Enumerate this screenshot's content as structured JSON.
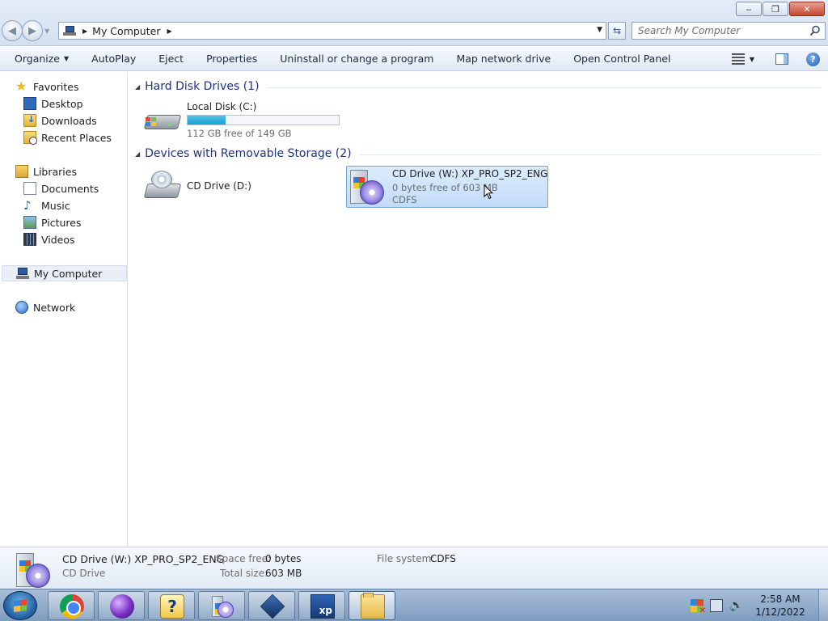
{
  "window": {
    "minimize_glyph": "‒",
    "restore_glyph": "❐",
    "close_glyph": "✕"
  },
  "nav": {
    "back_glyph": "◀",
    "forward_glyph": "▶"
  },
  "address": {
    "crumb": "My Computer",
    "dropdown_glyph": "▼"
  },
  "search": {
    "placeholder": "Search My Computer"
  },
  "toolbar": {
    "organize": "Organize",
    "autoplay": "AutoPlay",
    "eject": "Eject",
    "properties": "Properties",
    "uninstall": "Uninstall or change a program",
    "map_drive": "Map network drive",
    "control_panel": "Open Control Panel",
    "help_glyph": "?"
  },
  "sidebar": {
    "favorites": "Favorites",
    "desktop": "Desktop",
    "downloads": "Downloads",
    "recent": "Recent Places",
    "libraries": "Libraries",
    "documents": "Documents",
    "music": "Music",
    "pictures": "Pictures",
    "videos": "Videos",
    "computer": "My Computer",
    "network": "Network"
  },
  "groups": {
    "hdd": "Hard Disk Drives (1)",
    "removable": "Devices with Removable Storage (2)"
  },
  "drives": {
    "c": {
      "name": "Local Disk (C:)",
      "free": "112 GB free of 149 GB",
      "used_fraction": 0.25
    },
    "d": {
      "name": "CD Drive (D:)"
    },
    "w": {
      "name": "CD Drive (W:) XP_PRO_SP2_ENG",
      "free": "0 bytes free of 603 MB",
      "fs": "CDFS"
    }
  },
  "details": {
    "name": "CD Drive (W:) XP_PRO_SP2_ENG",
    "type": "CD Drive",
    "space_free_label": "Space free:",
    "space_free": "0 bytes",
    "total_size_label": "Total size:",
    "total_size": "603 MB",
    "fs_label": "File system:",
    "fs": "CDFS"
  },
  "tray": {
    "time": "2:58 AM",
    "date": "1/12/2022"
  },
  "taskbar": {
    "help_glyph": "?",
    "xp_label": "xp"
  },
  "colors": {
    "accent": "#1e3287",
    "selection": "#c1dcf8",
    "capacity_bar": "#1aa1cf"
  }
}
